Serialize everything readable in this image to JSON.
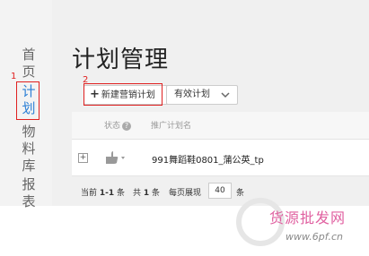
{
  "sidebar": {
    "items": [
      {
        "label_top": "首",
        "label_bottom": "页"
      },
      {
        "label_top": "计",
        "label_bottom": "划"
      },
      {
        "label_top": "物",
        "label_mid": "料",
        "label_bottom": "库"
      },
      {
        "label_top": "报",
        "label_bottom": "表"
      }
    ]
  },
  "annotations": {
    "one": "1",
    "two": "2"
  },
  "page": {
    "title": "计划管理"
  },
  "toolbar": {
    "new_button": "新建营销计划",
    "filter_value": "有效计划"
  },
  "table": {
    "headers": {
      "status": "状态",
      "name": "推广计划名"
    },
    "rows": [
      {
        "name": "991舞蹈鞋0801_蒲公英_tp"
      }
    ]
  },
  "pager": {
    "current_label": "当前",
    "current_range": "1-1",
    "current_unit": "条",
    "total_label": "共",
    "total_count": "1",
    "total_unit": "条",
    "size_label": "每页展现",
    "size_value": "40",
    "size_unit": "条"
  },
  "watermark": {
    "text": "货源批发网",
    "url": "www.6pf.cn"
  }
}
